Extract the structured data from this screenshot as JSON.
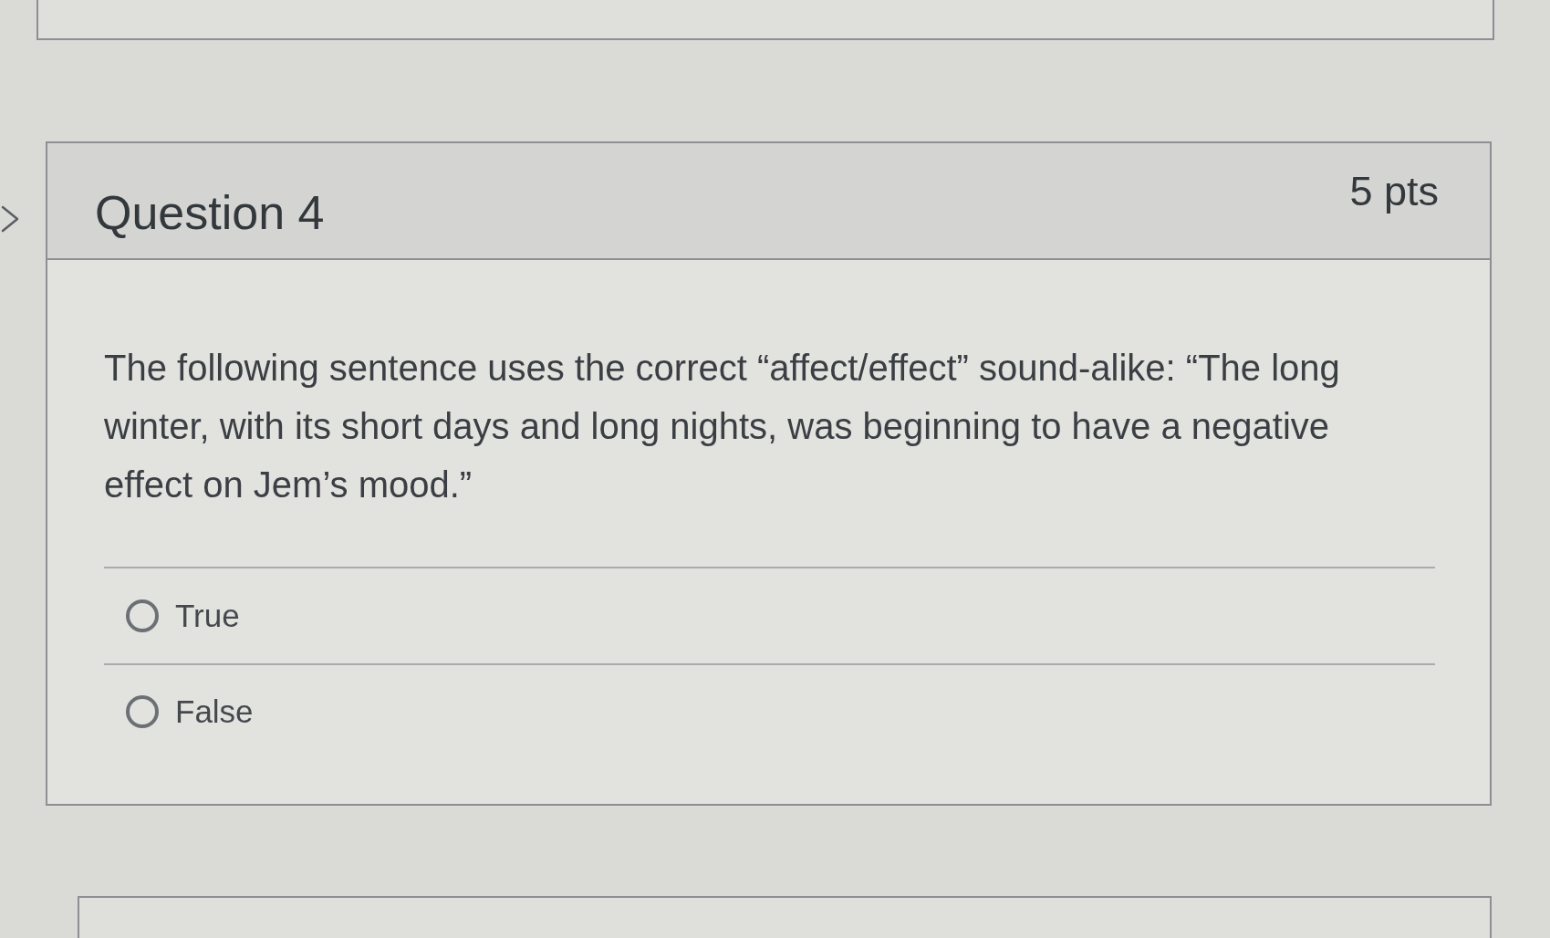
{
  "question": {
    "title": "Question 4",
    "points": "5 pts",
    "text": "The following sentence uses the correct “affect/effect” sound-alike: “The long winter, with its short days and long nights, was beginning to have a negative effect on Jem’s mood.”",
    "answers": [
      {
        "label": "True",
        "selected": false
      },
      {
        "label": "False",
        "selected": false
      }
    ]
  }
}
